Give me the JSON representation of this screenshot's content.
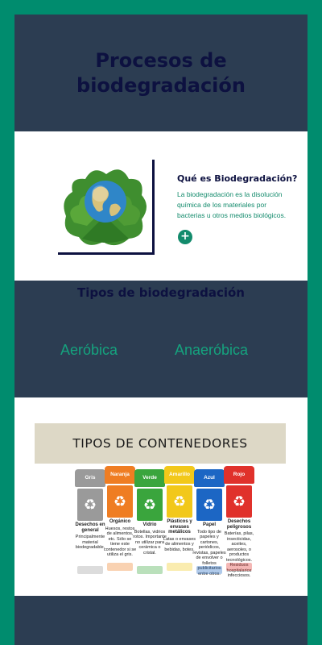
{
  "header": {
    "title": "Procesos de biodegradación"
  },
  "intro": {
    "title": "Qué es Biodegradación?",
    "text": "La biodegradación es la disolución química de los materiales por bacterias u otros medios biológicos.",
    "expand_label": "+",
    "image": "globe-on-leaves"
  },
  "types": {
    "title": "Tipos de biodegradación",
    "aerobic": "Aeróbica",
    "anaerobic": "Anaeróbica"
  },
  "bins": {
    "banner": "TIPOS DE CONTENEDORES",
    "items": [
      {
        "color_name": "Gris",
        "hex": "#9a9a9a",
        "name": "Desechos en general",
        "desc": "Principalmente material biodegradable."
      },
      {
        "color_name": "Naranja",
        "hex": "#ef7d22",
        "name": "Orgánico",
        "desc": "Huesos, restos de alimentos, etc. Sólo se tiene este contenedor si se utiliza el gris."
      },
      {
        "color_name": "Verde",
        "hex": "#3aa53d",
        "name": "Vidrio",
        "desc": "Botellas, vidrios rotos. Importante no utilizar para cerámica o cristal."
      },
      {
        "color_name": "Amarillo",
        "hex": "#f2c81a",
        "name": "Plásticos y envases metálicos",
        "desc": "Latas o envases de alimentos y bebidas, botes."
      },
      {
        "color_name": "Azul",
        "hex": "#1c66c4",
        "name": "Papel",
        "desc": "Todo tipo de papeles y cartones, periódicos, revistas, papeles de envolver o folletos publicitarios entre otros."
      },
      {
        "color_name": "Rojo",
        "hex": "#e0312b",
        "name": "Desechos peligrosos",
        "desc": "Baterías, pilas, insecticidas, aceites, aerosoles, o productos tecnológicos. Residuos hospitalarios infecciosos."
      }
    ]
  },
  "colors": {
    "background": "#008c6e",
    "panel": "#2c3d52",
    "heading": "#0d1140",
    "accent": "#15a37e"
  }
}
